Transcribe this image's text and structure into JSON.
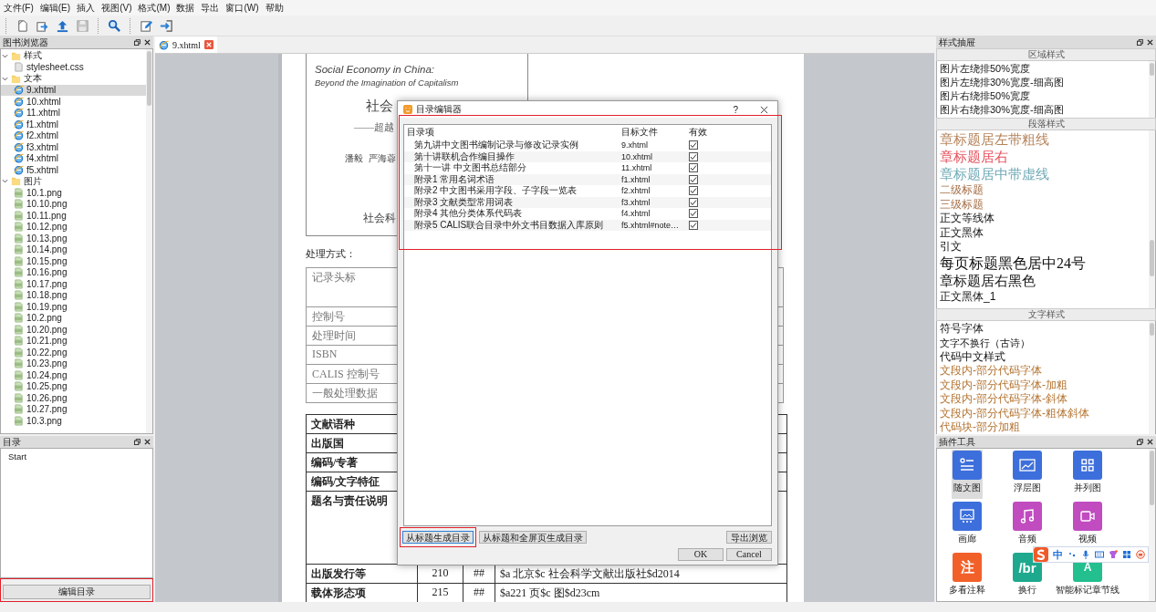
{
  "menu": [
    "文件(F)",
    "编辑(E)",
    "插入",
    "视图(V)",
    "格式(M)",
    "数据",
    "导出",
    "窗口(W)",
    "帮助"
  ],
  "book_browser": {
    "title": "图书浏览器",
    "tree": [
      {
        "label": "样式",
        "expanded": true,
        "children": [
          {
            "label": "stylesheet.css",
            "kind": "css",
            "selected": false
          }
        ]
      },
      {
        "label": "文本",
        "expanded": true,
        "children": [
          {
            "label": "9.xhtml",
            "kind": "html",
            "selected": true
          },
          {
            "label": "10.xhtml",
            "kind": "html",
            "selected": false
          },
          {
            "label": "11.xhtml",
            "kind": "html",
            "selected": false
          },
          {
            "label": "f1.xhtml",
            "kind": "html",
            "selected": false
          },
          {
            "label": "f2.xhtml",
            "kind": "html",
            "selected": false
          },
          {
            "label": "f3.xhtml",
            "kind": "html",
            "selected": false
          },
          {
            "label": "f4.xhtml",
            "kind": "html",
            "selected": false
          },
          {
            "label": "f5.xhtml",
            "kind": "html",
            "selected": false
          }
        ]
      },
      {
        "label": "图片",
        "expanded": true,
        "children": [
          {
            "label": "10.1.png",
            "kind": "image",
            "selected": false
          },
          {
            "label": "10.10.png",
            "kind": "image",
            "selected": false
          },
          {
            "label": "10.11.png",
            "kind": "image",
            "selected": false
          },
          {
            "label": "10.12.png",
            "kind": "image",
            "selected": false
          },
          {
            "label": "10.13.png",
            "kind": "image",
            "selected": false
          },
          {
            "label": "10.14.png",
            "kind": "image",
            "selected": false
          },
          {
            "label": "10.15.png",
            "kind": "image",
            "selected": false
          },
          {
            "label": "10.16.png",
            "kind": "image",
            "selected": false
          },
          {
            "label": "10.17.png",
            "kind": "image",
            "selected": false
          },
          {
            "label": "10.18.png",
            "kind": "image",
            "selected": false
          },
          {
            "label": "10.19.png",
            "kind": "image",
            "selected": false
          },
          {
            "label": "10.2.png",
            "kind": "image",
            "selected": false
          },
          {
            "label": "10.20.png",
            "kind": "image",
            "selected": false
          },
          {
            "label": "10.21.png",
            "kind": "image",
            "selected": false
          },
          {
            "label": "10.22.png",
            "kind": "image",
            "selected": false
          },
          {
            "label": "10.23.png",
            "kind": "image",
            "selected": false
          },
          {
            "label": "10.24.png",
            "kind": "image",
            "selected": false
          },
          {
            "label": "10.25.png",
            "kind": "image",
            "selected": false
          },
          {
            "label": "10.26.png",
            "kind": "image",
            "selected": false
          },
          {
            "label": "10.27.png",
            "kind": "image",
            "selected": false
          },
          {
            "label": "10.3.png",
            "kind": "image",
            "selected": false
          }
        ]
      }
    ]
  },
  "toc_panel": {
    "title": "目录",
    "items": [
      "Start"
    ],
    "button": "编辑目录"
  },
  "editor_tab": {
    "label": "9.xhtml"
  },
  "document": {
    "title_en": "Social Economy in China:",
    "subtitle_en": "Beyond the Imagination of Capitalism",
    "title_zh": "社会",
    "subtitle_zh": "——超越",
    "authors": "潘毅  严海蓉",
    "publisher": "社会科",
    "section_label": "处理方式：",
    "table_1": [
      {
        "label": "记录头标",
        "kind": "tall"
      },
      {
        "label": "控制号",
        "kind": "normal"
      },
      {
        "label": "处理时间",
        "kind": "normal"
      },
      {
        "label": "ISBN",
        "kind": "normal"
      },
      {
        "label": "CALIS 控制号",
        "kind": "normal"
      },
      {
        "label": "一般处理数据",
        "kind": "normal"
      }
    ],
    "table_2": [
      {
        "label": "文献语种",
        "kind": "normal"
      },
      {
        "label": "出版国",
        "kind": "normal"
      },
      {
        "label": "编码/专著",
        "kind": "normal"
      },
      {
        "label": "编码/文字特征",
        "kind": "normal"
      },
      {
        "label": "题名与责任说明",
        "kind": "tall"
      },
      {
        "label": "出版发行等",
        "kind": "normal",
        "cells": [
          "210",
          "##",
          "$a 北京$c 社会科学文献出版社$d2014"
        ]
      },
      {
        "label": "载体形态项",
        "kind": "normal",
        "cells": [
          "215",
          "##",
          "$a221 页$c 图$d23cm"
        ]
      }
    ]
  },
  "toc_dialog": {
    "title": "目录编辑器",
    "help": "?",
    "columns": [
      "目录项",
      "目标文件",
      "有效"
    ],
    "rows": [
      {
        "item": "第九讲中文图书编制记录与修改记录实例",
        "file": "9.xhtml",
        "checked": true
      },
      {
        "item": "第十讲联机合作编目操作",
        "file": "10.xhtml",
        "checked": true
      },
      {
        "item": "第十一讲 中文图书总结部分",
        "file": "11.xhtml",
        "checked": true
      },
      {
        "item": "附录1 常用名词术语",
        "file": "f1.xhtml",
        "checked": true
      },
      {
        "item": "附录2 中文图书采用字段、子字段一览表",
        "file": "f2.xhtml",
        "checked": true
      },
      {
        "item": "附录3 文献类型常用词表",
        "file": "f3.xhtml",
        "checked": true
      },
      {
        "item": "附录4 其他分类体系代码表",
        "file": "f4.xhtml",
        "checked": true
      },
      {
        "item": "附录5 CALIS联合目录中外文书目数据入库原则",
        "file": "f5.xhtml#note…",
        "checked": true
      }
    ],
    "generate_buttons": [
      "从标题生成目录",
      "从标题和全屏页生成目录"
    ],
    "export_button": "导出浏览",
    "ok_button": "OK",
    "cancel_button": "Cancel"
  },
  "style_drawer": {
    "title": "样式抽屉",
    "sections": [
      {
        "title": "区域样式",
        "items": [
          {
            "label": "图片左绕排50%宽度",
            "kind": "small"
          },
          {
            "label": "图片左绕排30%宽度-细高图",
            "kind": "small"
          },
          {
            "label": "图片右绕排50%宽度",
            "kind": "small"
          },
          {
            "label": "图片右绕排30%宽度-细高图",
            "kind": "small"
          }
        ]
      },
      {
        "title": "段落样式",
        "items": [
          {
            "label": "章标题居左带粗线",
            "kind": "large",
            "color": "#b5835a"
          },
          {
            "label": "章标题居右",
            "kind": "large",
            "color": "#e5505c"
          },
          {
            "label": "章标题居中带虚线",
            "kind": "large",
            "color": "#6fa9b5"
          },
          {
            "label": "二级标题",
            "kind": "medium",
            "color": "#a36b42"
          },
          {
            "label": "三级标题",
            "kind": "medium",
            "color": "#a36b42"
          },
          {
            "label": "正文等线体",
            "kind": "medium"
          },
          {
            "label": "正文黑体",
            "kind": "medium"
          },
          {
            "label": "引文",
            "kind": "medium"
          },
          {
            "label": "每页标题黑色居中24号",
            "kind": "xlarge"
          },
          {
            "label": "章标题居右黑色",
            "kind": "large"
          },
          {
            "label": "正文黑体_1",
            "kind": "medium"
          }
        ]
      },
      {
        "title": "文字样式",
        "items": [
          {
            "label": "符号字体",
            "kind": "medium"
          },
          {
            "label": "文字不换行（古诗）",
            "kind": "small"
          },
          {
            "label": "代码中文样式",
            "kind": "medium"
          },
          {
            "label": "文段内-部分代码字体",
            "kind": "medium",
            "color": "#b3722e"
          },
          {
            "label": "文段内-部分代码字体-加粗",
            "kind": "medium",
            "color": "#b3722e"
          },
          {
            "label": "文段内-部分代码字体-斜体",
            "kind": "medium",
            "color": "#b3722e"
          },
          {
            "label": "文段内-部分代码字体-粗体斜体",
            "kind": "medium",
            "color": "#b3722e"
          },
          {
            "label": "代码块-部分加粗",
            "kind": "medium",
            "color": "#b3722e"
          }
        ]
      }
    ]
  },
  "plugin_tools": {
    "title": "插件工具",
    "items": [
      {
        "label": "随文图",
        "kind": "figure",
        "selected": true,
        "color": "#3d6fdc"
      },
      {
        "label": "浮层图",
        "kind": "float",
        "selected": false,
        "color": "#3d6fdc"
      },
      {
        "label": "并列图",
        "kind": "grid",
        "selected": false,
        "color": "#3d6fdc"
      },
      {
        "label": "画廊",
        "kind": "gallery",
        "selected": false,
        "color": "#3d6fdc"
      },
      {
        "label": "音频",
        "kind": "audio",
        "selected": false,
        "color": "#c04cc0"
      },
      {
        "label": "视频",
        "kind": "video",
        "selected": false,
        "color": "#c04cc0"
      },
      {
        "label": "多看注释",
        "kind": "note",
        "icon_text": "注",
        "selected": false,
        "color": "#f2602a"
      },
      {
        "label": "换行",
        "kind": "linebreak",
        "icon_text": "/br",
        "selected": false,
        "color": "#1ea98e"
      },
      {
        "label": "智能标记章节线",
        "kind": "chapter",
        "icon_text": "A",
        "selected": false,
        "color": "#23bf8e"
      }
    ]
  },
  "ime_toolbar": {
    "label": "中"
  }
}
